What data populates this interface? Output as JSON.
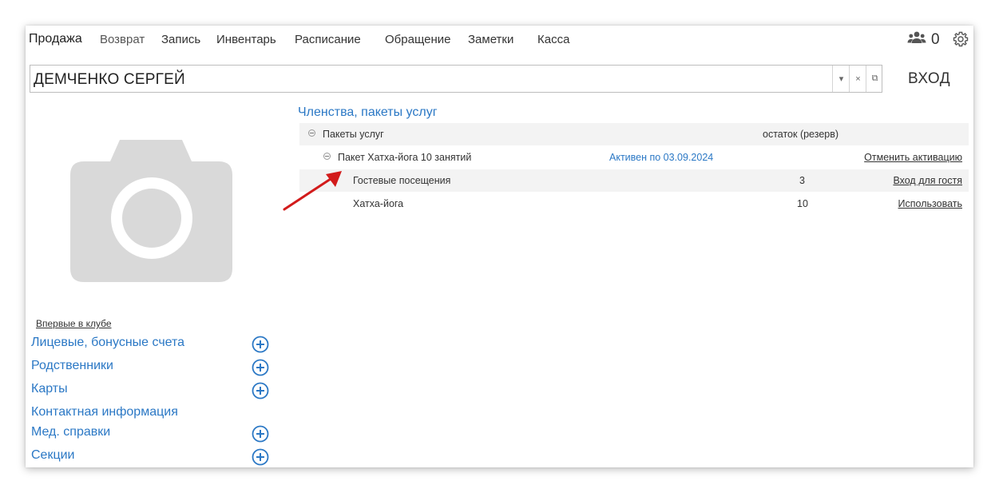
{
  "nav": {
    "items": [
      "Продажа",
      "Возврат",
      "Запись",
      "Инвентарь",
      "Расписание",
      "Обращение",
      "Заметки",
      "Касса"
    ],
    "users_count": "0"
  },
  "client": {
    "name": "ДЕМЧЕНКО СЕРГЕЙ",
    "dropdown_icon": "▾",
    "clear_icon": "×",
    "open_icon": "⧉",
    "enter_label": "ВХОД"
  },
  "left": {
    "first_time": "Впервые в клубе",
    "links": [
      {
        "label": "Лицевые, бонусные счета",
        "has_add": true
      },
      {
        "label": "Родственники",
        "has_add": true
      },
      {
        "label": "Карты",
        "has_add": true
      },
      {
        "label": "Контактная информация",
        "has_add": false
      },
      {
        "label": "Мед. справки",
        "has_add": true
      },
      {
        "label": "Секции",
        "has_add": true
      }
    ]
  },
  "memberships": {
    "title": "Членства, пакеты услуг",
    "group_label": "Пакеты услуг",
    "group_column": "остаток (резерв)",
    "package": {
      "name": "Пакет Хатха-йога 10 занятий",
      "status": "Активен по 03.09.2024",
      "action": "Отменить активацию"
    },
    "services": [
      {
        "name": "Гостевые посещения",
        "remaining": "3",
        "action": "Вход для гостя"
      },
      {
        "name": "Хатха-йога",
        "remaining": "10",
        "action": "Использовать"
      }
    ]
  },
  "colors": {
    "accent_blue": "#2b78c5",
    "arrow_red": "#d21b1b",
    "photo_gray": "#d9d9d9"
  }
}
